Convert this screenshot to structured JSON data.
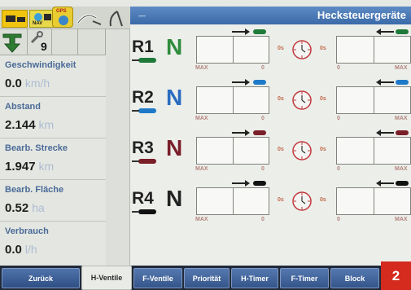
{
  "status_bar": {
    "nav_label": "NAV",
    "gps_label": "GPS"
  },
  "tool_bar": {
    "counter": "9"
  },
  "info_panel": {
    "items": [
      {
        "label": "Geschwindigkeit",
        "value": "0.0",
        "unit": "km/h"
      },
      {
        "label": "Abstand",
        "value": "2.144",
        "unit": "km"
      },
      {
        "label": "Bearb. Strecke",
        "value": "1.947",
        "unit": "km"
      },
      {
        "label": "Bearb. Fläche",
        "value": "0.52",
        "unit": "ha"
      },
      {
        "label": "Verbrauch",
        "value": "0.0",
        "unit": "l/h"
      }
    ]
  },
  "header": {
    "title": "Hecksteuergeräte"
  },
  "valves": [
    {
      "name": "R1",
      "mode": "N",
      "mode_color": "#2e8b3c",
      "hose_color": "#1f7a3a",
      "time_left": "0s",
      "time_right": "0s",
      "max_left": "MAX",
      "zero_left": "0",
      "zero_right": "0",
      "max_right": "MAX"
    },
    {
      "name": "R2",
      "mode": "N",
      "mode_color": "#2a6cc0",
      "hose_color": "#1e7ac9",
      "time_left": "0s",
      "time_right": "0s",
      "max_left": "MAX",
      "zero_left": "0",
      "zero_right": "0",
      "max_right": "MAX"
    },
    {
      "name": "R3",
      "mode": "N",
      "mode_color": "#7a1e2a",
      "hose_color": "#7a1e28",
      "time_left": "0s",
      "time_right": "0s",
      "max_left": "MAX",
      "zero_left": "0",
      "zero_right": "0",
      "max_right": "MAX"
    },
    {
      "name": "R4",
      "mode": "N",
      "mode_color": "#222222",
      "hose_color": "#111111",
      "time_left": "0s",
      "time_right": "0s",
      "max_left": "MAX",
      "zero_left": "0",
      "zero_right": "0",
      "max_right": "MAX"
    }
  ],
  "tabs": {
    "back": "Zurück",
    "h_ventile": "H-Ventile",
    "f_ventile": "F-Ventile",
    "prioritaet": "Priorität",
    "h_timer": "H-Timer",
    "f_timer": "F-Timer",
    "block": "Block"
  },
  "corner_badge": "2"
}
